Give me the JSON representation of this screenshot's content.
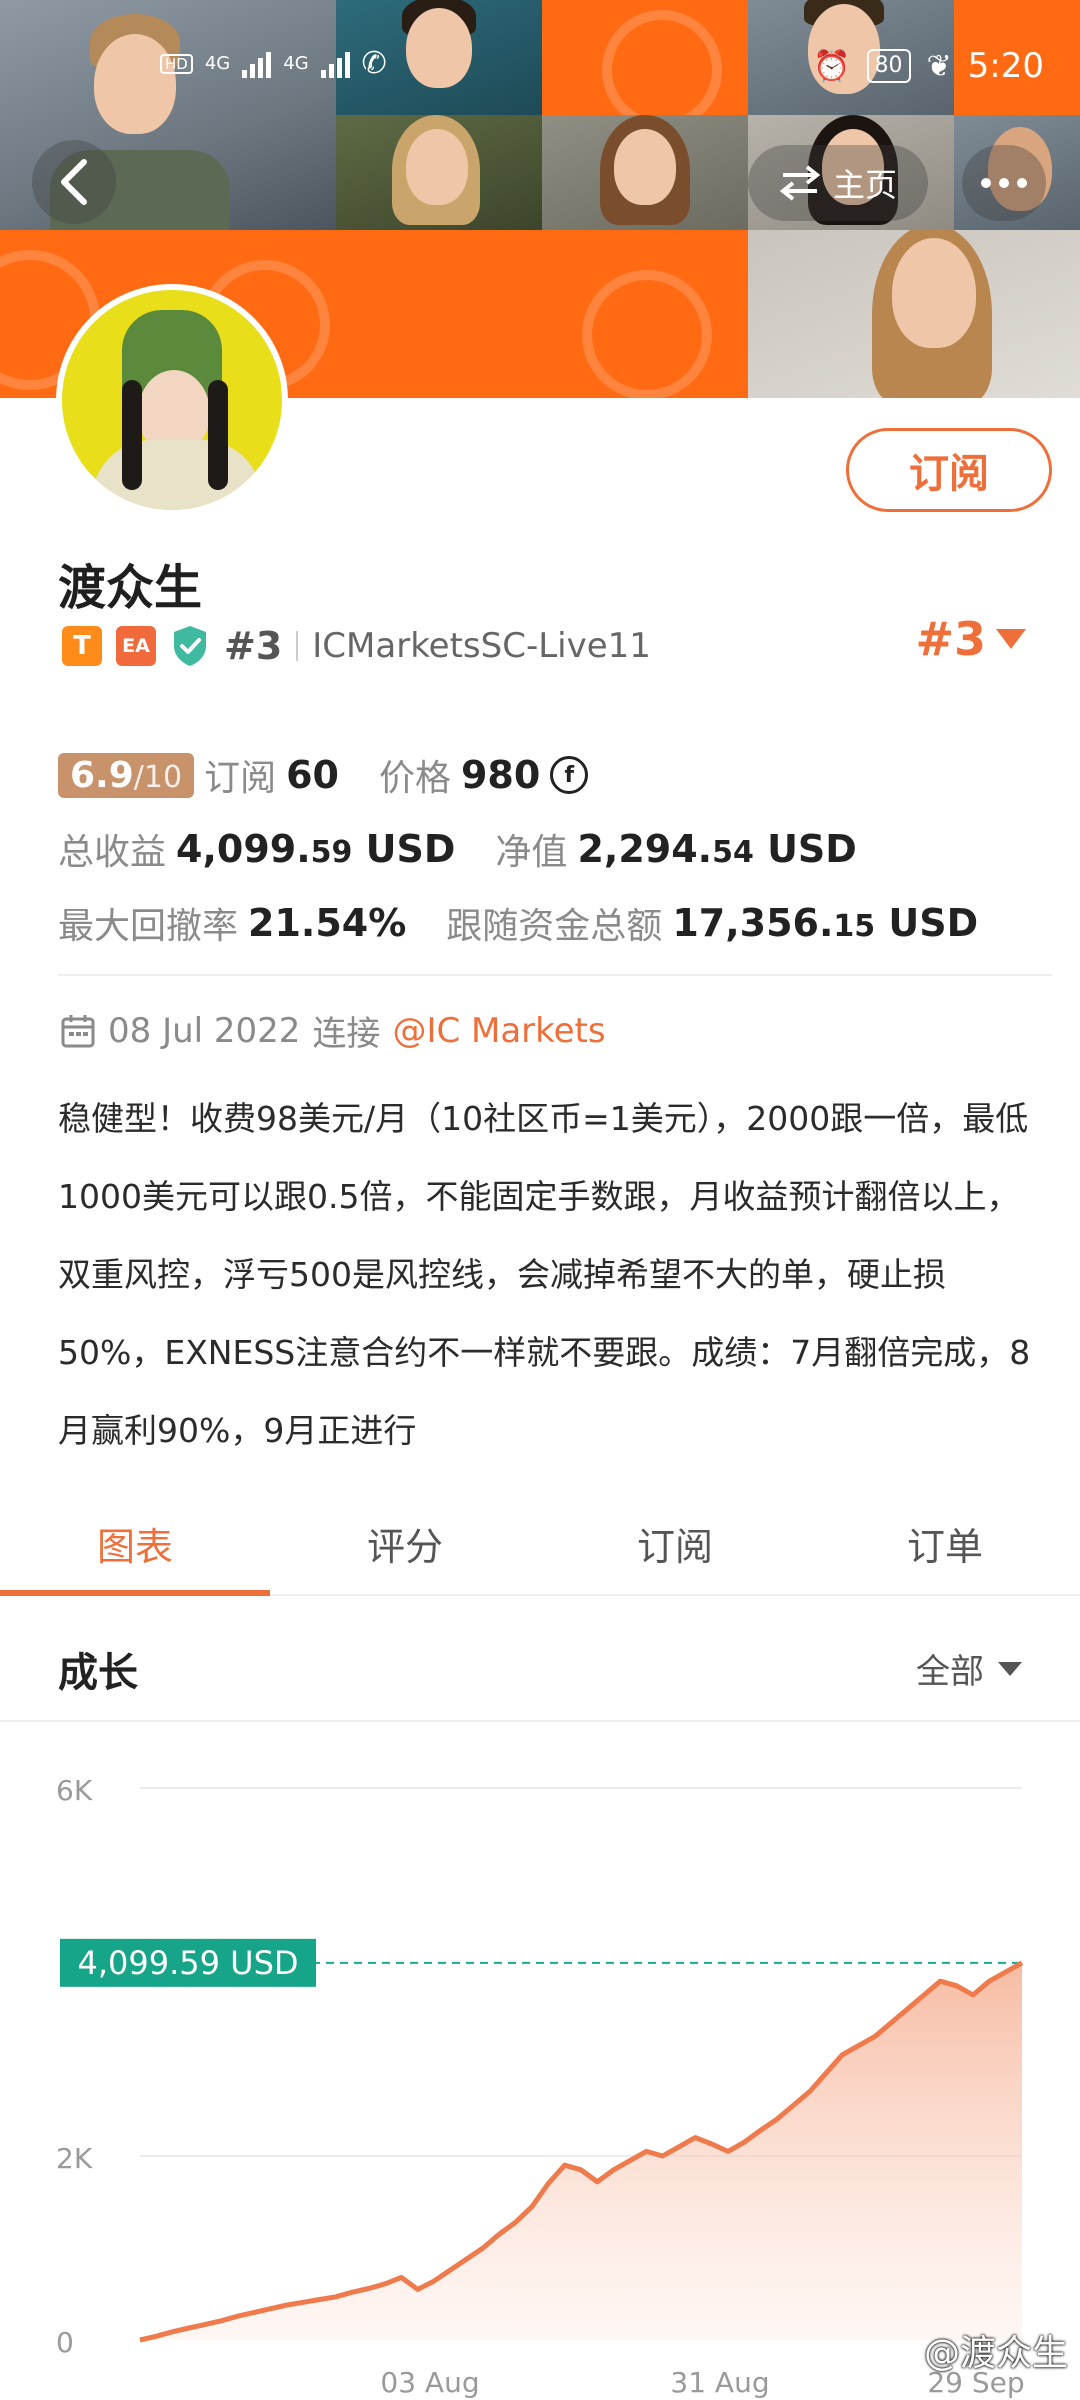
{
  "status_bar": {
    "time": "5:20",
    "battery": "80",
    "signal_labels": [
      "4G",
      "4G"
    ]
  },
  "header": {
    "home_label": "主页",
    "subscribe_label": "订阅"
  },
  "profile": {
    "name": "渡众生",
    "badge_t": "T",
    "badge_ea": "EA",
    "rank_small": "#3",
    "broker": "ICMarketsSC-Live11",
    "rank_big": "#3"
  },
  "stats": {
    "score": "6.9",
    "score_max": "/10",
    "subscribe_label": "订阅",
    "subscribe_count": "60",
    "price_label": "价格",
    "price_value": "980",
    "coin_symbol": "f",
    "total_profit_label": "总收益",
    "total_profit_main": "4,099.",
    "total_profit_cents": "59",
    "total_profit_unit": "USD",
    "equity_label": "净值",
    "equity_main": "2,294.",
    "equity_cents": "54",
    "equity_unit": "USD",
    "drawdown_label": "最大回撤率",
    "drawdown_value": "21.54%",
    "follow_label": "跟随资金总额",
    "follow_main": "17,356.",
    "follow_cents": "15",
    "follow_unit": "USD"
  },
  "meta": {
    "date": "08 Jul 2022",
    "connect_label": "连接",
    "market": "@IC Markets"
  },
  "description": "稳健型！收费98美元/月（10社区币=1美元），2000跟一倍，最低1000美元可以跟0.5倍，不能固定手数跟，月收益预计翻倍以上，双重风控，浮亏500是风控线，会减掉希望不大的单，硬止损50%，EXNESS注意合约不一样就不要跟。成绩：7月翻倍完成，8月赢利90%，9月正进行",
  "tabs": [
    {
      "label": "图表",
      "active": true
    },
    {
      "label": "评分",
      "active": false
    },
    {
      "label": "订阅",
      "active": false
    },
    {
      "label": "订单",
      "active": false
    }
  ],
  "section": {
    "title": "成长",
    "filter": "全部"
  },
  "chart_data": {
    "type": "area",
    "title": "",
    "y_ticks": [
      "6K",
      "2K",
      "0"
    ],
    "y_tick_values": [
      6000,
      2000,
      0
    ],
    "x_ticks": [
      "03 Aug",
      "31 Aug",
      "29 Sep"
    ],
    "ylim": [
      0,
      6000
    ],
    "current_value_label": "4,099.59 USD",
    "current_value": 4099.59,
    "color": "#ef7a4b",
    "series": [
      {
        "values": [
          0,
          40,
          90,
          130,
          170,
          210,
          260,
          300,
          340,
          380,
          410,
          440,
          470,
          520,
          560,
          610,
          680,
          550,
          640,
          760,
          880,
          1000,
          1150,
          1280,
          1450,
          1700,
          1900,
          1850,
          1720,
          1850,
          1950,
          2050,
          2000,
          2100,
          2200,
          2130,
          2050,
          2150,
          2280,
          2400,
          2550,
          2700,
          2900,
          3100,
          3200,
          3300,
          3450,
          3600,
          3750,
          3900,
          3850,
          3750,
          3900,
          4000,
          4099.59
        ]
      }
    ],
    "grid": true,
    "watermark": "@渡众生"
  }
}
